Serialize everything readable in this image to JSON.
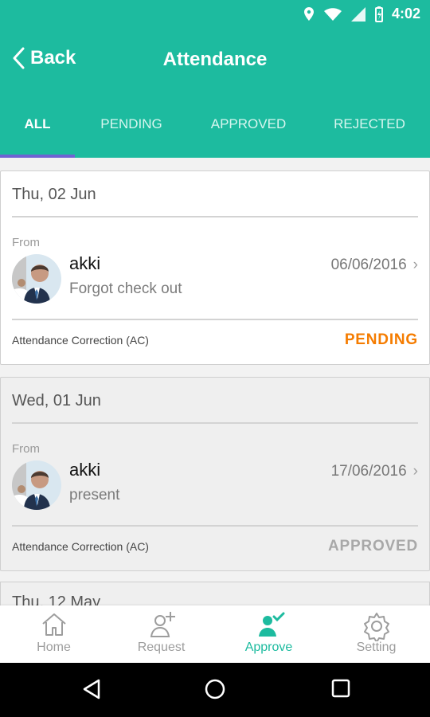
{
  "status": {
    "time": "4:02"
  },
  "toolbar": {
    "back_label": "Back",
    "title": "Attendance"
  },
  "tabs": [
    {
      "label": "ALL",
      "active": true
    },
    {
      "label": "PENDING",
      "active": false
    },
    {
      "label": "APPROVED",
      "active": false
    },
    {
      "label": "REJECTED",
      "active": false
    }
  ],
  "cards": [
    {
      "date": "Thu, 02 Jun",
      "from_label": "From",
      "name": "akki",
      "reason": "Forgot check out",
      "request_date": "06/06/2016",
      "type": "Attendance Correction (AC)",
      "status": "PENDING",
      "status_color": "#f57c00"
    },
    {
      "date": "Wed, 01 Jun",
      "from_label": "From",
      "name": "akki",
      "reason": "present",
      "request_date": "17/06/2016",
      "type": "Attendance Correction (AC)",
      "status": "APPROVED",
      "status_color": "#a8a8a8"
    }
  ],
  "partial_card": {
    "date": "Thu, 12 May"
  },
  "bottom_nav": [
    {
      "label": "Home",
      "icon": "home-icon",
      "active": false
    },
    {
      "label": "Request",
      "icon": "add-person-icon",
      "active": false
    },
    {
      "label": "Approve",
      "icon": "approve-person-icon",
      "active": true
    },
    {
      "label": "Setting",
      "icon": "gear-icon",
      "active": false
    }
  ],
  "colors": {
    "primary": "#1dbb9f",
    "tab_indicator": "#6f63d3",
    "pending": "#f57c00",
    "approved": "#a8a8a8"
  }
}
